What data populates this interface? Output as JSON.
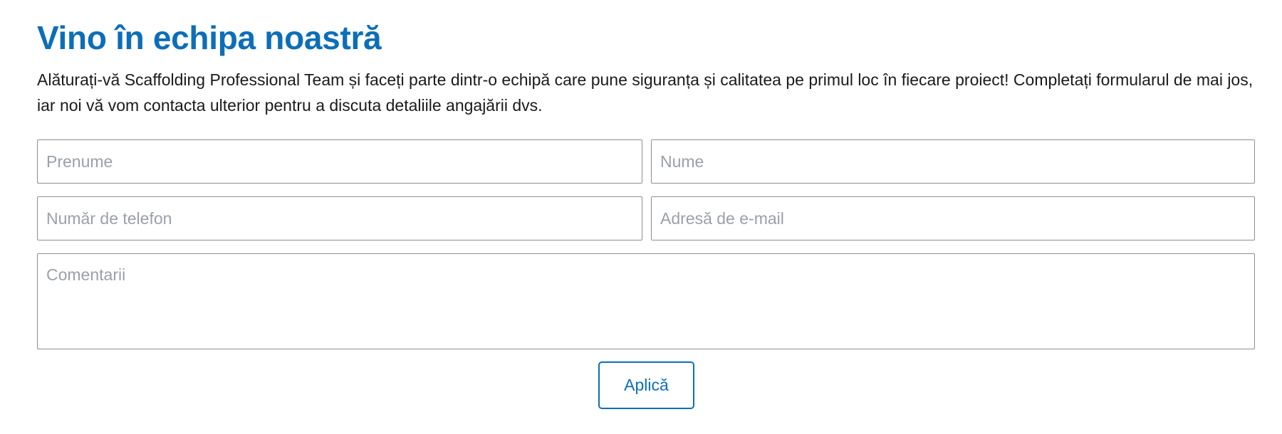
{
  "section": {
    "title": "Vino în echipa noastră",
    "intro": "Alăturați-vă Scaffolding Professional Team și faceți parte dintr-o echipă care pune siguranța și calitatea pe primul loc în fiecare proiect! Completați formularul de mai jos, iar noi vă vom contacta ulterior pentru a discuta detaliile angajării dvs."
  },
  "form": {
    "first_name": {
      "value": "",
      "placeholder": "Prenume"
    },
    "last_name": {
      "value": "",
      "placeholder": "Nume"
    },
    "phone": {
      "value": "",
      "placeholder": "Număr de telefon"
    },
    "email": {
      "value": "",
      "placeholder": "Adresă de e-mail"
    },
    "comments": {
      "value": "",
      "placeholder": "Comentarii"
    },
    "submit_label": "Aplică"
  },
  "colors": {
    "accent": "#0d6eb8",
    "text": "#1a1a1a",
    "placeholder": "#9aa0a8",
    "border": "#8a8f96"
  }
}
